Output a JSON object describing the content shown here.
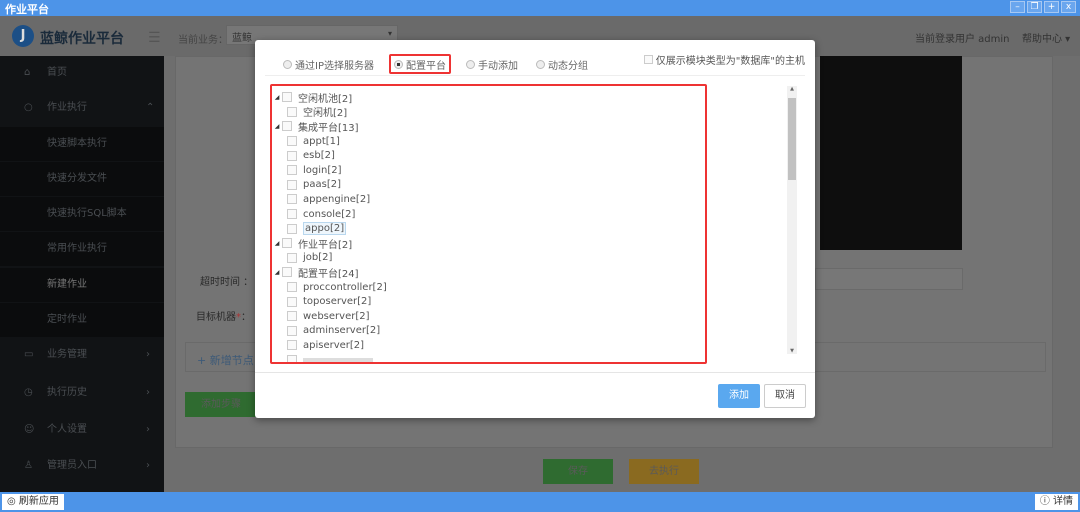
{
  "window": {
    "title": "作业平台",
    "controls": [
      "–",
      "❐",
      "+",
      "x"
    ]
  },
  "header": {
    "logo_letter": "J",
    "brand": "蓝鲸作业平台",
    "business_label": "当前业务：",
    "business_value": "蓝鲸",
    "user": "当前登录用户  admin",
    "help": "帮助中心 ▾"
  },
  "sidebar": {
    "items": [
      {
        "label": "首页",
        "icon": "⌂"
      },
      {
        "label": "作业执行",
        "icon": "○",
        "arrow": "⌃"
      },
      {
        "label": "快速脚本执行"
      },
      {
        "label": "快速分发文件"
      },
      {
        "label": "快速执行SQL脚本"
      },
      {
        "label": "常用作业执行"
      },
      {
        "label": "新建作业"
      },
      {
        "label": "定时作业"
      },
      {
        "label": "业务管理",
        "icon": "▭",
        "arrow": "›"
      },
      {
        "label": "执行历史",
        "icon": "◷",
        "arrow": "›"
      },
      {
        "label": "个人设置",
        "icon": "☺",
        "arrow": "›"
      },
      {
        "label": "管理员入口",
        "icon": "♙",
        "arrow": "›"
      }
    ]
  },
  "form": {
    "timeout_label": "超时时间 ：",
    "target_label": "目标机器",
    "required": "*",
    "target_colon": "：",
    "add_node": "+ 新增节点",
    "add_step": "添加步骤",
    "save": "保存",
    "execute": "去执行"
  },
  "modal": {
    "options": [
      {
        "label": "通过IP选择服务器",
        "selected": false
      },
      {
        "label": "配置平台",
        "selected": true
      },
      {
        "label": "手动添加",
        "selected": false
      },
      {
        "label": "动态分组",
        "selected": false
      }
    ],
    "db_filter": "仅展示模块类型为\"数据库\"的主机",
    "tree": [
      {
        "label": "空闲机池[2]",
        "children": [
          "空闲机[2]"
        ]
      },
      {
        "label": "集成平台[13]",
        "children": [
          "appt[1]",
          "esb[2]",
          "login[2]",
          "paas[2]",
          "appengine[2]",
          "console[2]",
          "appo[2]"
        ]
      },
      {
        "label": "作业平台[2]",
        "children": [
          "job[2]"
        ]
      },
      {
        "label": "配置平台[24]",
        "children": [
          "proccontroller[2]",
          "toposerver[2]",
          "webserver[2]",
          "adminserver[2]",
          "apiserver[2]"
        ]
      }
    ],
    "highlighted_node": "appo[2]",
    "add": "添加",
    "cancel": "取消"
  },
  "statusbar": {
    "refresh": "刷新应用",
    "detail": "详情"
  },
  "colors": {
    "accent": "#4d94e8",
    "primary_button": "#5aa8ef",
    "highlight_border": "#e33333"
  }
}
